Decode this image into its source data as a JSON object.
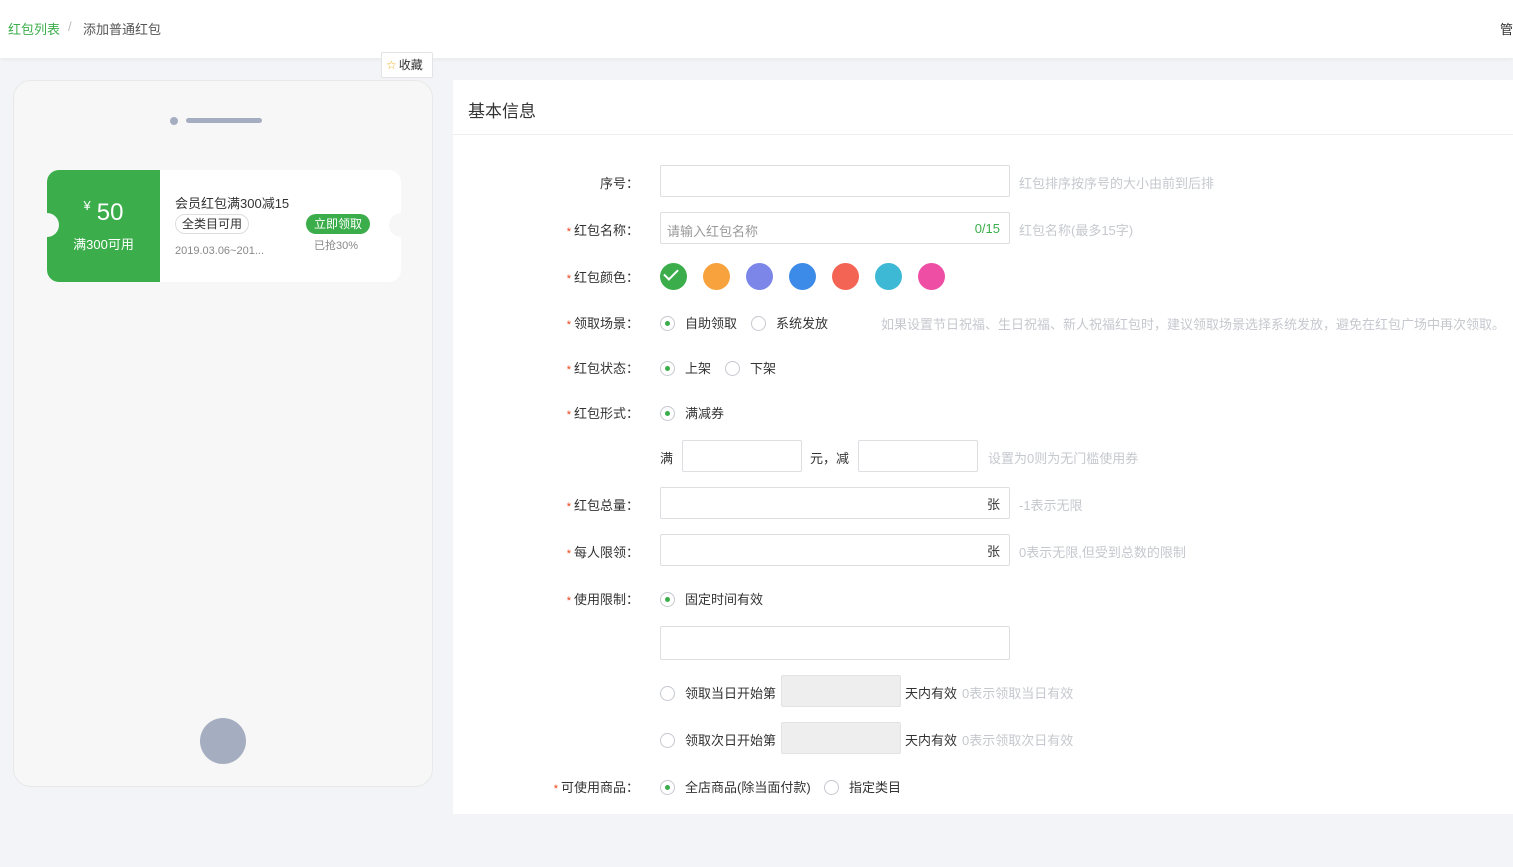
{
  "breadcrumb": {
    "parent": "红包列表",
    "separator": "/",
    "current": "添加普通红包"
  },
  "header": {
    "right_text": "管"
  },
  "favorite": {
    "icon": "star-icon",
    "label": "收藏"
  },
  "preview": {
    "currency": "¥",
    "amount": "50",
    "condition": "满300可用",
    "title": "会员红包满300减15",
    "tag": "全类目可用",
    "date": "2019.03.06~201...",
    "button": "立即领取",
    "grabbed": "已抢30%"
  },
  "section_title": "基本信息",
  "form": {
    "seq": {
      "label": "序号：",
      "value": "",
      "hint": "红包排序按序号的大小由前到后排"
    },
    "name": {
      "label": "红包名称：",
      "placeholder": "请输入红包名称",
      "count": "0/15",
      "hint": "红包名称(最多15字)"
    },
    "color": {
      "label": "红包颜色：",
      "options": [
        "#3bae4b",
        "#f7a23c",
        "#7b86e8",
        "#3d8be8",
        "#f36455",
        "#3db9d5",
        "#ee4fa5"
      ],
      "selected": 0
    },
    "scene": {
      "label": "领取场景：",
      "options": [
        "自助领取",
        "系统发放"
      ],
      "selected": 0,
      "hint": "如果设置节日祝福、生日祝福、新人祝福红包时，建议领取场景选择系统发放，避免在红包广场中再次领取。"
    },
    "status": {
      "label": "红包状态：",
      "options": [
        "上架",
        "下架"
      ],
      "selected": 0
    },
    "type": {
      "label": "红包形式：",
      "options": [
        "满减券"
      ],
      "selected": 0
    },
    "threshold": {
      "prefix": "满",
      "middle": "元，减",
      "hint": "设置为0则为无门槛使用券"
    },
    "total": {
      "label": "红包总量：",
      "unit": "张",
      "hint": "-1表示无限"
    },
    "per_user": {
      "label": "每人限领：",
      "unit": "张",
      "hint": "0表示无限,但受到总数的限制"
    },
    "usage": {
      "label": "使用限制：",
      "option_fixed": "固定时间有效",
      "option_same_day_pre": "领取当日开始第",
      "option_same_day_post": "天内有效",
      "option_same_day_hint": "0表示领取当日有效",
      "option_next_day_pre": "领取次日开始第",
      "option_next_day_post": "天内有效",
      "option_next_day_hint": "0表示领取次日有效"
    },
    "goods": {
      "label": "可使用商品：",
      "options": [
        "全店商品(除当面付款)",
        "指定类目"
      ],
      "selected": 0
    }
  }
}
